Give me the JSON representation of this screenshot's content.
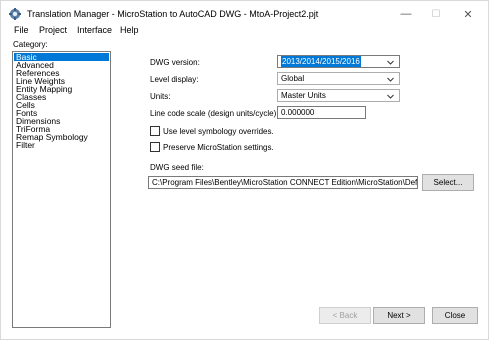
{
  "window": {
    "title": "Translation Manager - MicroStation to AutoCAD DWG - MtoA-Project2.pjt",
    "icon": "gear-app-icon",
    "minimize": "—",
    "maximize": "☐",
    "close": "✕"
  },
  "menu": [
    "File",
    "Project",
    "Interface",
    "Help"
  ],
  "category": {
    "label": "Category:",
    "items": [
      "Basic",
      "Advanced",
      "References",
      "Line Weights",
      "Entity Mapping",
      "Classes",
      "Cells",
      "Fonts",
      "Dimensions",
      "TriForma",
      "Remap Symbology",
      "Filter"
    ],
    "selected": "Basic"
  },
  "form": {
    "dwg_version_label": "DWG version:",
    "dwg_version_value": "2013/2014/2015/2016",
    "level_display_label": "Level display:",
    "level_display_value": "Global",
    "units_label": "Units:",
    "units_value": "Master Units",
    "line_code_label": "Line code scale (design units/cycle):",
    "line_code_value": "0.000000",
    "use_level_symbology_label": "Use level symbology overrides.",
    "use_level_symbology_checked": false,
    "preserve_label": "Preserve MicroStation settings.",
    "preserve_checked": false,
    "seed_file_label": "DWG seed file:",
    "seed_file_value": "C:\\Program Files\\Bentley\\MicroStation CONNECT Edition\\MicroStation\\Default\\seed",
    "select_button": "Select..."
  },
  "footer": {
    "back_button": "< Back",
    "next_button": "Next >",
    "close_button": "Close"
  },
  "colors": {
    "selection": "#0078d7",
    "button_face": "#e1e1e1"
  }
}
